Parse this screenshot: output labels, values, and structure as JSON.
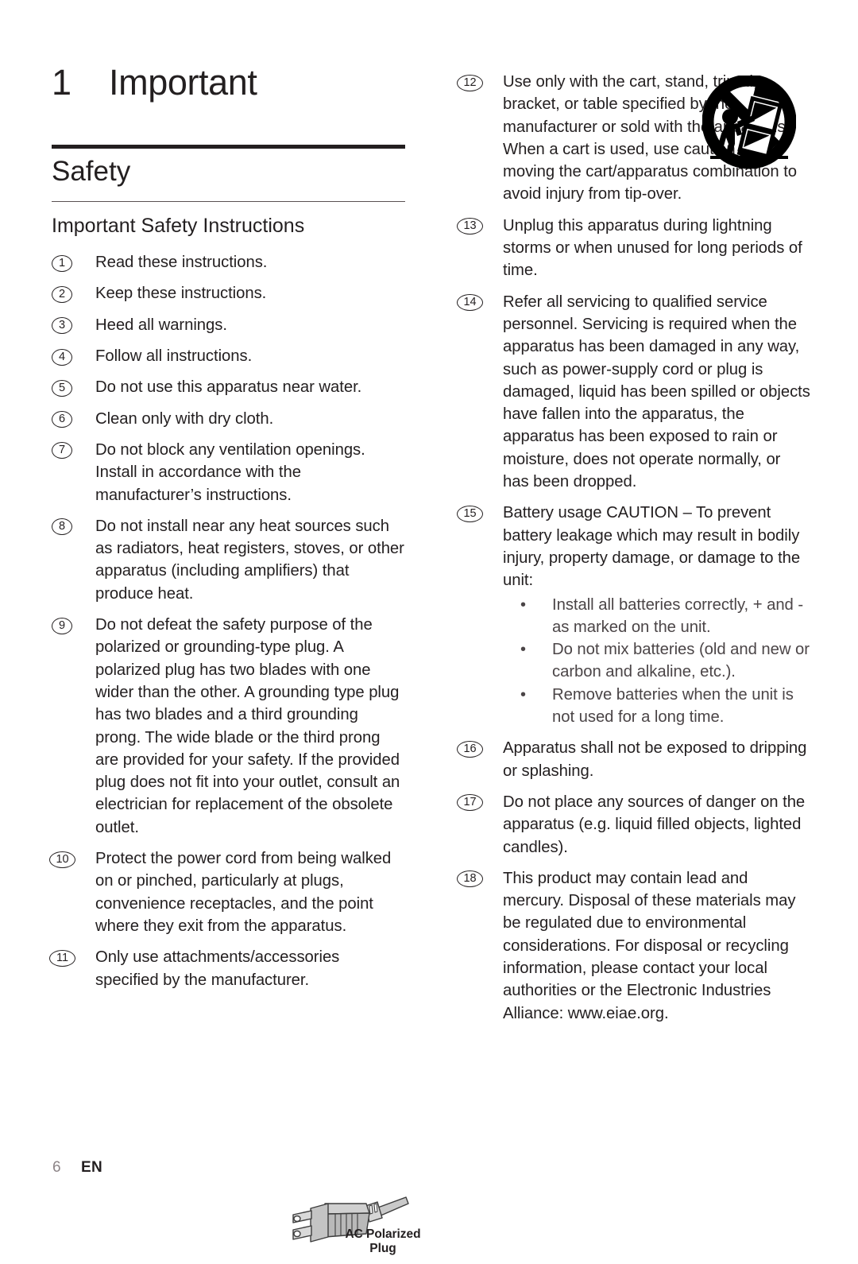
{
  "chapter": {
    "number": "1",
    "title": "Important"
  },
  "section": {
    "title": "Safety"
  },
  "subsection": {
    "title": "Important Safety Instructions"
  },
  "left_column": {
    "items": [
      {
        "num": "1",
        "text": "Read these instructions."
      },
      {
        "num": "2",
        "text": "Keep these instructions."
      },
      {
        "num": "3",
        "text": "Heed all warnings."
      },
      {
        "num": "4",
        "text": "Follow all instructions."
      },
      {
        "num": "5",
        "text": "Do not use this apparatus near water."
      },
      {
        "num": "6",
        "text": "Clean only with dry cloth."
      },
      {
        "num": "7",
        "text": "Do not block any ventilation openings. Install in accordance with the manufacturer’s instructions."
      },
      {
        "num": "8",
        "text": "Do not install near any heat sources such as radiators, heat registers, stoves, or other apparatus (including amplifiers) that produce heat."
      },
      {
        "num": "9",
        "text": "Do not defeat the safety purpose of the polarized or grounding-type plug. A polarized plug has two blades with one wider than the other. A grounding type plug has two blades and a third grounding prong. The wide blade or the third prong are provided for your safety. If the provided plug does not fit into your outlet, consult an electrician for replacement of the obsolete outlet."
      },
      {
        "num": "10",
        "text": "Protect the power cord from being walked on or pinched, particularly at plugs, convenience receptacles, and the point where they exit from the apparatus."
      },
      {
        "num": "11",
        "text": "Only use attachments/accessories specified by the manufacturer."
      }
    ]
  },
  "right_column": {
    "items": [
      {
        "num": "12",
        "text": "Use only with the cart, stand, tripod, bracket, or table specified by the manufacturer or sold with the apparatus. When a cart is used, use caution when moving the cart/apparatus combination to avoid injury from tip-over."
      },
      {
        "num": "13",
        "text": "Unplug this apparatus during lightning storms or when unused for long periods of time."
      },
      {
        "num": "14",
        "text": "Refer all servicing to qualified service personnel. Servicing is required when the apparatus has been damaged in any way, such as power-supply cord or plug is damaged, liquid has been spilled or objects have fallen into the apparatus, the apparatus has been exposed to rain or moisture, does not operate normally, or has been dropped."
      },
      {
        "num": "15",
        "text": "Battery usage CAUTION – To prevent battery leakage which may result in bodily injury, property damage, or damage to the unit:"
      },
      {
        "num": "16",
        "text": "Apparatus shall not be exposed to dripping or splashing."
      },
      {
        "num": "17",
        "text": "Do not place any sources of danger on the apparatus (e.g. liquid filled objects, lighted candles)."
      },
      {
        "num": "18",
        "text": "This product may contain lead and mercury. Disposal of these materials may be regulated due to environmental considerations. For disposal or recycling information, please contact your local authorities or the Electronic Industries Alliance: www.eiae.org."
      }
    ],
    "battery_bullets": [
      "Install all batteries correctly, + and - as marked on the unit.",
      "Do not mix batteries (old and new or carbon and alkaline, etc.).",
      "Remove batteries when the unit is not used for a long time."
    ],
    "bullet_glyph": "•"
  },
  "figures": {
    "plug_caption_line1": "AC Polarized",
    "plug_caption_line2": "Plug",
    "plug_icon": "ac-polarized-plug-illustration",
    "cart_icon": "cart-tip-over-warning-symbol"
  },
  "footer": {
    "page_number": "6",
    "language": "EN"
  },
  "colors": {
    "text": "#231f20",
    "muted_text": "#4b4547",
    "page_number": "#8c8487",
    "rule_thick": "#231f20",
    "rule_thin": "#5a5153",
    "background": "#ffffff"
  }
}
